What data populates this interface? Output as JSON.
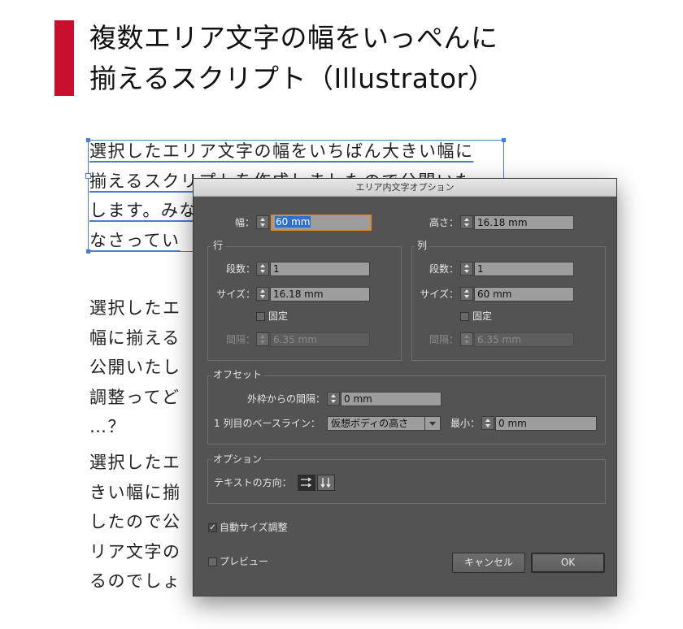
{
  "article": {
    "title_lines": [
      "複数エリア文字の幅をいっぺんに",
      "揃えるスクリプト（Illustrator）"
    ],
    "para1_lines": [
      "選択したエリア文字の幅をいちばん大きい幅に",
      "揃えるスクリプトを作成しましたので公開いた",
      "します。みな",
      "なさってい"
    ],
    "para2_lines": [
      "選択したエ",
      "幅に揃える",
      "公開いたし",
      "調整ってど",
      "…？"
    ],
    "para3_lines": [
      "選択したエ",
      "きい幅に揃",
      "したので公",
      "リア文字の",
      "るのでしょ"
    ]
  },
  "dialog": {
    "title": "エリア内文字オプション",
    "width_label": "幅：",
    "width_value": "60 mm",
    "height_label": "高さ：",
    "height_value": "16.18 mm",
    "rows": {
      "title": "行",
      "count_label": "段数：",
      "count_value": "1",
      "size_label": "サイズ：",
      "size_value": "16.18 mm",
      "fixed_label": "固定",
      "gutter_label": "間隔：",
      "gutter_value": "6.35 mm"
    },
    "columns": {
      "title": "列",
      "count_label": "段数：",
      "count_value": "1",
      "size_label": "サイズ：",
      "size_value": "60 mm",
      "fixed_label": "固定",
      "gutter_label": "間隔：",
      "gutter_value": "6.35 mm"
    },
    "offset": {
      "title": "オフセット",
      "inset_label": "外枠からの間隔：",
      "inset_value": "0 mm",
      "baseline_label": "1 列目のベースライン：",
      "baseline_value": "仮想ボディの高さ",
      "min_label": "最小：",
      "min_value": "0 mm"
    },
    "options": {
      "title": "オプション",
      "direction_label": "テキストの方向："
    },
    "autosize_label": "自動サイズ調整",
    "autosize_checked": true,
    "preview_label": "プレビュー",
    "preview_checked": false,
    "cancel_label": "キャンセル",
    "ok_label": "OK"
  }
}
